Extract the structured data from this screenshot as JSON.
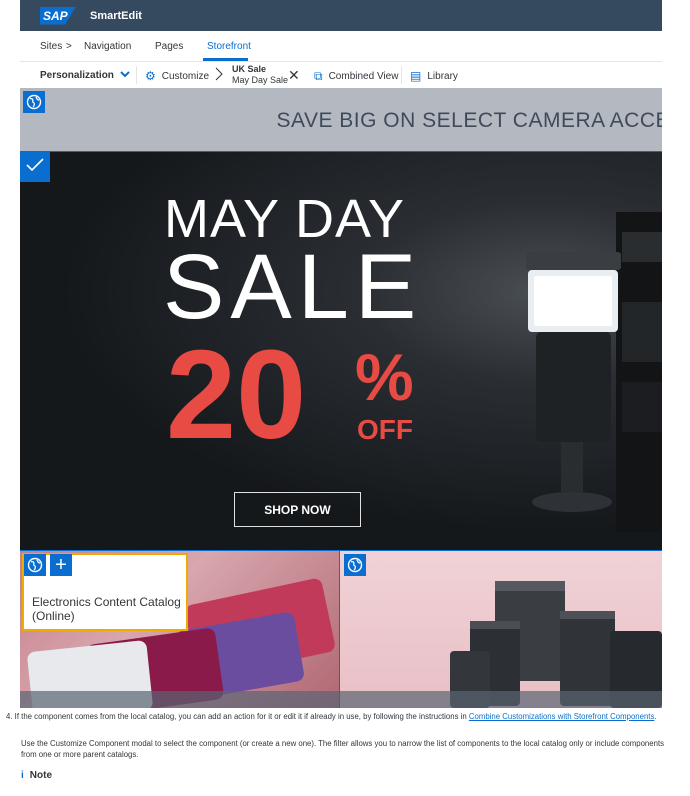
{
  "header": {
    "brand": "SAP",
    "app_name": "SmartEdit"
  },
  "nav": {
    "sites": "Sites",
    "separator": ">",
    "navigation": "Navigation",
    "pages": "Pages",
    "storefront": "Storefront"
  },
  "toolbar": {
    "personalization": "Personalization",
    "customize": "Customize",
    "context_title": "UK Sale",
    "context_subtitle": "May Day Sale",
    "combined_view": "Combined View",
    "library": "Library"
  },
  "storefront": {
    "banner_text": "SAVE BIG ON SELECT CAMERA ACCE",
    "hero_line1": "MAY DAY",
    "hero_line2": "SALE",
    "hero_percent": "20",
    "hero_percent_sign": "%",
    "hero_off": "OFF",
    "shop_now": "SHOP NOW",
    "catalog_tooltip": "Electronics Content Catalog (Online)"
  },
  "doc": {
    "step_text": "4. If the component comes from the local catalog, you can add an action for it or edit it if already in use, by following the instructions in ",
    "step_link": "Combine Customizations with Storefront Components",
    "step_end": ".",
    "paragraph": "Use the Customize Component modal to select the component (or create a new one). The filter allows you to narrow the list of components to the local catalog only or include components from one or more parent catalogs.",
    "note_icon": "i",
    "note_label": "Note"
  },
  "colors": {
    "accent": "#0a6ed1",
    "sale_red": "#e84a44",
    "header": "#354a5f",
    "highlight": "#f0ab00"
  }
}
